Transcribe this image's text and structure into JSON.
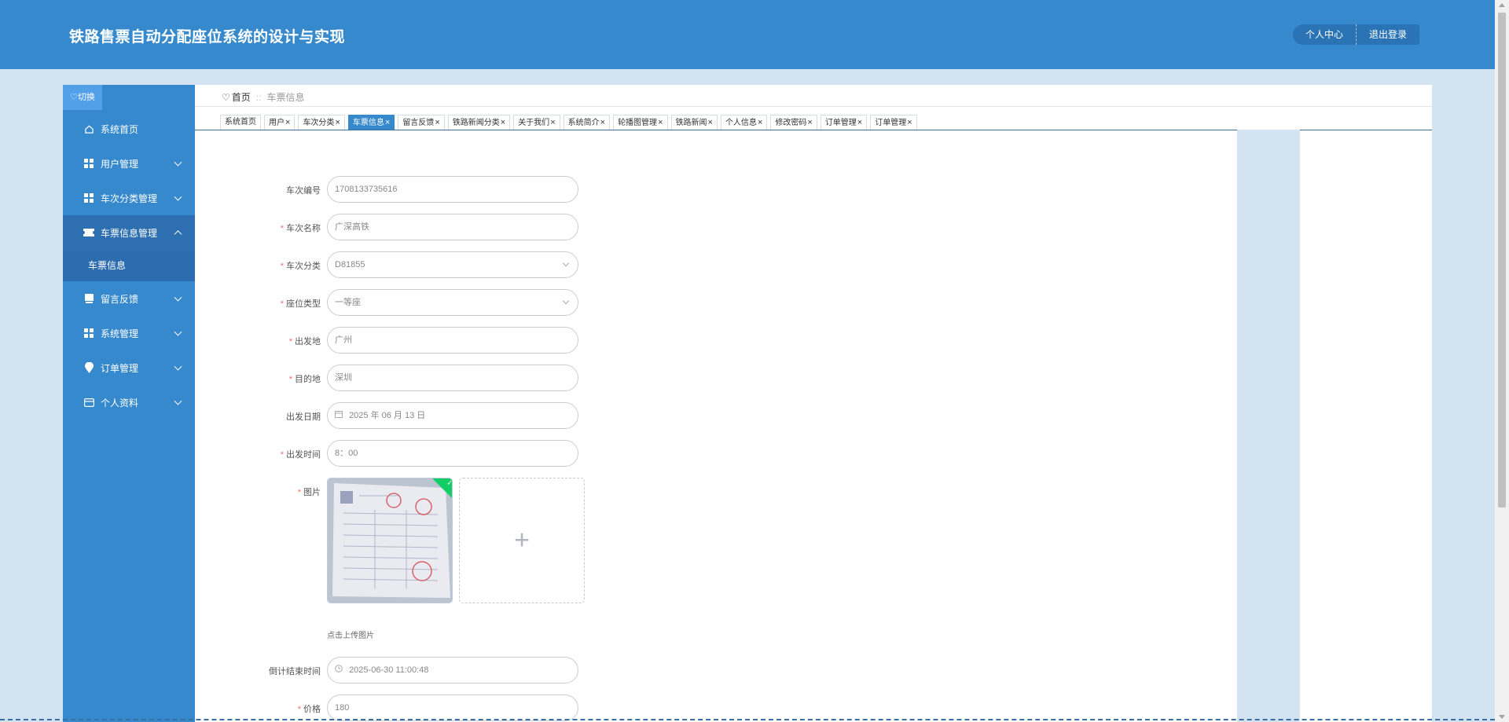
{
  "header": {
    "title": "铁路售票自动分配座位系统的设计与实现",
    "personal_center": "个人中心",
    "logout": "退出登录"
  },
  "sidebar": {
    "toggle": "切换",
    "items": [
      {
        "label": "系统首页",
        "icon": "home-icon"
      },
      {
        "label": "用户管理",
        "icon": "grid-icon"
      },
      {
        "label": "车次分类管理",
        "icon": "grid-icon"
      },
      {
        "label": "车票信息管理",
        "icon": "ticket-icon",
        "expanded": true,
        "children": [
          "车票信息"
        ]
      },
      {
        "label": "留言反馈",
        "icon": "book-icon"
      },
      {
        "label": "系统管理",
        "icon": "grid-icon"
      },
      {
        "label": "订单管理",
        "icon": "location-icon"
      },
      {
        "label": "个人资料",
        "icon": "card-icon"
      }
    ]
  },
  "breadcrumb": {
    "home": "首页",
    "separator": "::",
    "current": "车票信息"
  },
  "tabs": [
    {
      "label": "系统首页",
      "closable": false
    },
    {
      "label": "用户",
      "closable": true
    },
    {
      "label": "车次分类",
      "closable": true
    },
    {
      "label": "车票信息",
      "closable": true,
      "active": true
    },
    {
      "label": "留言反馈",
      "closable": true
    },
    {
      "label": "铁路新闻分类",
      "closable": true
    },
    {
      "label": "关于我们",
      "closable": true
    },
    {
      "label": "系统简介",
      "closable": true
    },
    {
      "label": "轮播图管理",
      "closable": true
    },
    {
      "label": "铁路新闻",
      "closable": true
    },
    {
      "label": "个人信息",
      "closable": true
    },
    {
      "label": "修改密码",
      "closable": true
    },
    {
      "label": "订单管理",
      "closable": true
    },
    {
      "label": "订单管理",
      "closable": true
    }
  ],
  "form": {
    "train_no": {
      "label": "车次编号",
      "value": "1708133735616",
      "required": false
    },
    "train_name": {
      "label": "车次名称",
      "value": "广深高铁",
      "required": true
    },
    "train_category": {
      "label": "车次分类",
      "value": "D81855",
      "required": true
    },
    "seat_type": {
      "label": "座位类型",
      "value": "一等座",
      "required": true
    },
    "departure": {
      "label": "出发地",
      "value": "广州",
      "required": true
    },
    "destination": {
      "label": "目的地",
      "value": "深圳",
      "required": true
    },
    "depart_date": {
      "label": "出发日期",
      "value": "2025 年 06 月 13 日",
      "required": false
    },
    "depart_time": {
      "label": "出发时间",
      "value": "8：00",
      "required": true
    },
    "image": {
      "label": "图片",
      "required": true,
      "upload_tip": "点击上传图片",
      "add_symbol": "+"
    },
    "countdown_end": {
      "label": "倒计结束时间",
      "value": "2025-06-30 11:00:48",
      "required": false
    },
    "price": {
      "label": "价格",
      "value": "180",
      "required": true
    }
  },
  "required_mark": "*",
  "colors": {
    "header_bg": "#3689cd",
    "sidebar_bg": "#3689cd",
    "active_tab": "#3689cd",
    "required": "#f56c6c",
    "success_corner": "#13ce66"
  }
}
